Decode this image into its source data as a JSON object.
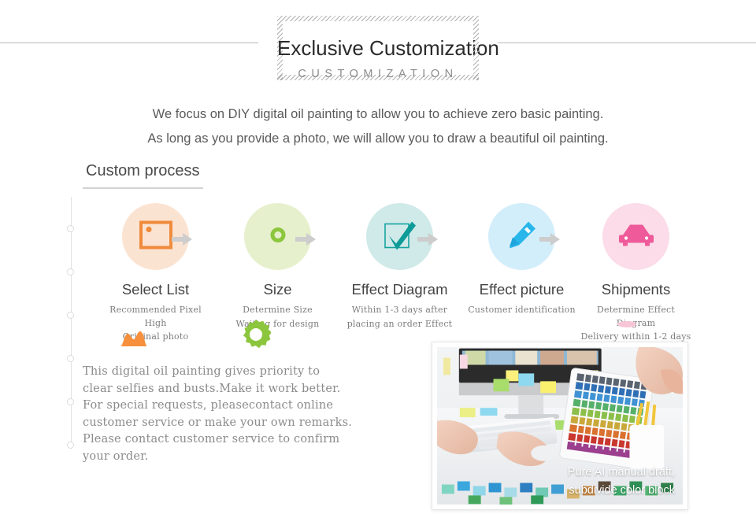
{
  "header": {
    "title_main": "Exclusive Customization",
    "title_sub": "CUSTOMIZATION"
  },
  "intro": {
    "line1": "We focus on DIY digital oil painting to allow you to achieve zero basic painting.",
    "line2": "As long as you provide a photo, we will allow you to draw a beautiful oil painting."
  },
  "section": {
    "title": "Custom process"
  },
  "process": {
    "steps": [
      {
        "label": "Select List",
        "sub_line1": "Recommended Pixel High",
        "sub_line2": "Original photo",
        "icon": "image-frame-icon",
        "circle_color": "#fbe3d2",
        "icon_color": "#f08b3c"
      },
      {
        "label": "Size",
        "sub_line1": "Determine Size",
        "sub_line2": "Waiting for design",
        "icon": "ring-dot-icon",
        "circle_color": "#e6f0cd",
        "icon_color": "#8cc63e"
      },
      {
        "label": "Effect Diagram",
        "sub_line1": "Within 1-3 days after",
        "sub_line2": "placing an order Effect",
        "icon": "checkbox-check-icon",
        "circle_color": "#cfeae8",
        "icon_color": "#17a3a0"
      },
      {
        "label": "Effect picture",
        "sub_line1": "Customer identification",
        "sub_line2": "",
        "icon": "pencil-icon",
        "circle_color": "#d3eefb",
        "icon_color": "#29b6ea"
      },
      {
        "label": "Shipments",
        "sub_line1": "Determine Effect Diagram",
        "sub_line2": "Delivery within 1-2 days",
        "icon": "car-icon",
        "circle_color": "#fbdce8",
        "icon_color": "#ef5a9a"
      }
    ],
    "arrow_icon": "arrow-right-icon",
    "arrow_color": "#cdcdcd"
  },
  "decor": {
    "mountain_icon": "mountain-shape",
    "mountain_color": "#f6903d",
    "gear_icon": "gear-shape",
    "gear_color": "#8cc63e",
    "blush_icon": "blush-shape",
    "blush_color": "#f7c6d6"
  },
  "body_copy": {
    "line1": "This digital oil painting gives priority to",
    "line2": "clear selfies and busts.Make it work better.",
    "line3": "For special requests, pleasecontact online",
    "line4": "customer service or make your own remarks.",
    "line5": "Please contact customer service to confirm",
    "line6": "your order."
  },
  "photo": {
    "caption_line1": "Pure AI manual draft,",
    "caption_line2": "subdivide color block",
    "alt": "designer-desk-photo"
  }
}
